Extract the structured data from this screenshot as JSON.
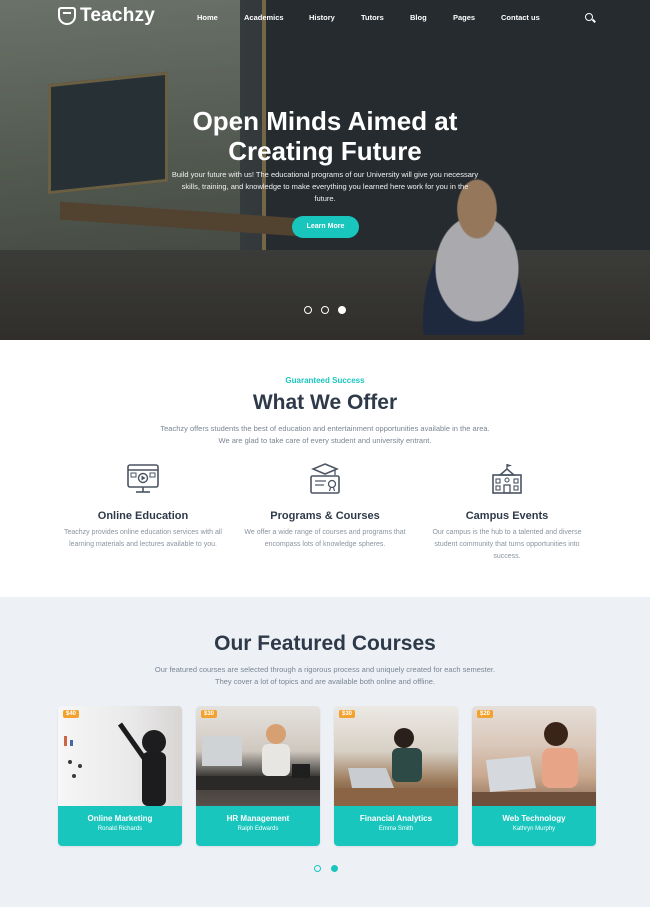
{
  "brand": {
    "name": "Teachzy",
    "accent": "#19c6be",
    "badge": "#f2a22d"
  },
  "nav": {
    "items": [
      {
        "label": "Home"
      },
      {
        "label": "Academics"
      },
      {
        "label": "History"
      },
      {
        "label": "Tutors"
      },
      {
        "label": "Blog"
      },
      {
        "label": "Pages"
      },
      {
        "label": "Contact us"
      }
    ],
    "search_icon": "search-icon"
  },
  "hero": {
    "title_line1": "Open Minds Aimed at",
    "title_line2": "Creating Future",
    "text": "Build your future with us! The educational programs of our University will give you necessary skills, training, and knowledge to make everything you learned here work for you in the future.",
    "button": "Learn More",
    "slides": 3,
    "active_slide": 3
  },
  "offer": {
    "kicker": "Guaranteed Success",
    "title": "What We Offer",
    "subtitle_line1": "Teachzy offers students the best of education and entertainment opportunities available in the area.",
    "subtitle_line2": "We are glad to take care of every student and university entrant.",
    "features": [
      {
        "icon": "online-education-icon",
        "title": "Online Education",
        "text": "Teachzy provides online education services with all learning materials and lectures available to you."
      },
      {
        "icon": "certificate-icon",
        "title": "Programs & Courses",
        "text": "We offer a wide range of courses and programs that encompass lots of knowledge spheres."
      },
      {
        "icon": "campus-building-icon",
        "title": "Campus Events",
        "text": "Our campus is the hub to a talented and diverse student community that turns opportunities into success."
      }
    ]
  },
  "courses": {
    "title": "Our Featured Courses",
    "subtitle_line1": "Our featured courses are selected through a rigorous process and uniquely created for each semester.",
    "subtitle_line2": "They cover a lot of topics and are available both online and offline.",
    "cards": [
      {
        "price": "$40",
        "title": "Online Marketing",
        "author": "Ronald Richards"
      },
      {
        "price": "$30",
        "title": "HR Management",
        "author": "Ralph Edwards"
      },
      {
        "price": "$30",
        "title": "Financial Analytics",
        "author": "Emma Smith"
      },
      {
        "price": "$20",
        "title": "Web Technology",
        "author": "Kathryn Murphy"
      }
    ],
    "pages": 2,
    "active_page": 2
  }
}
